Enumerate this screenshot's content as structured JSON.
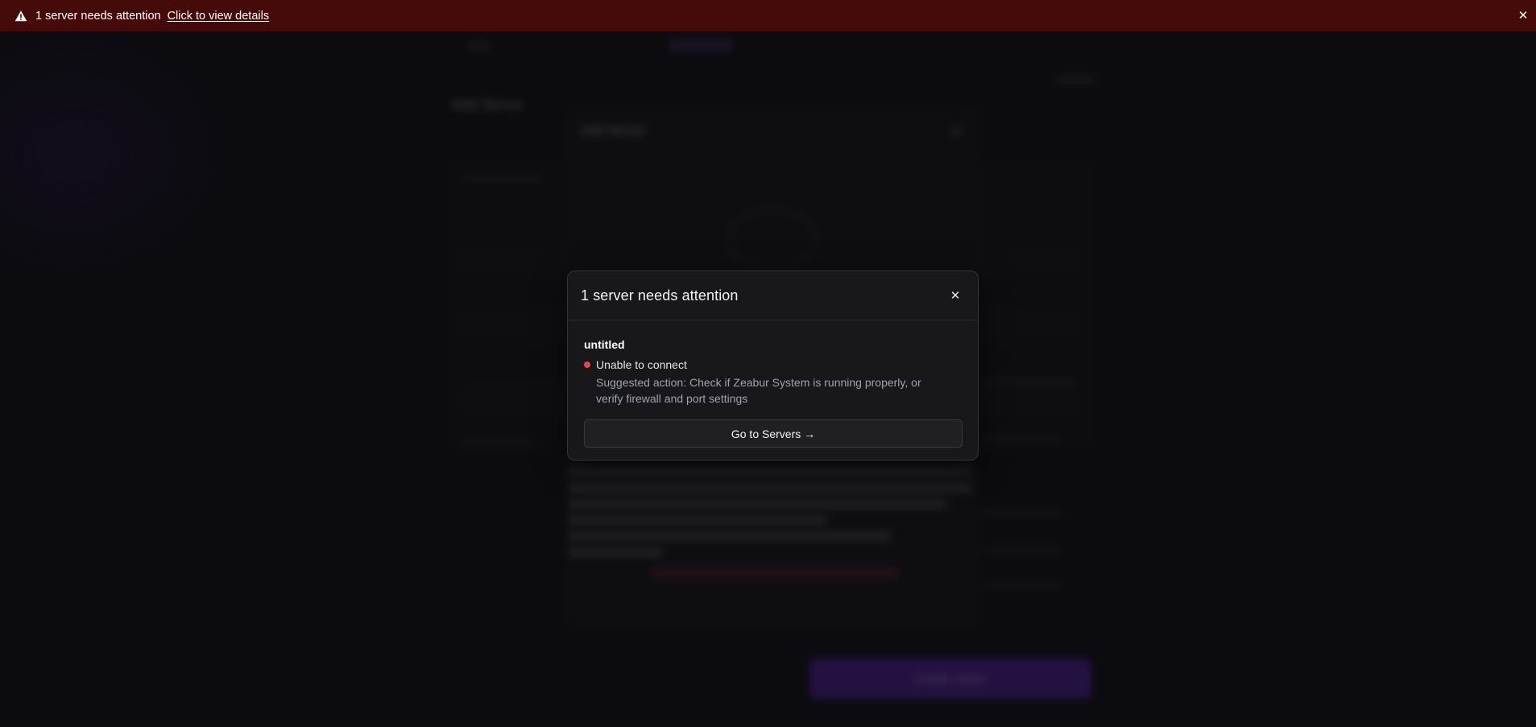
{
  "banner": {
    "message": "1 server needs attention",
    "link_label": "Click to view details",
    "close_glyph": "✕",
    "icon": "warning-icon",
    "background": "#450a0a"
  },
  "dialog": {
    "title": "1 server needs attention",
    "close_glyph": "✕",
    "server": {
      "name": "untitled",
      "status": "Unable to connect",
      "status_color": "#ef4444",
      "suggestion": "Suggested action: Check if Zeabur System is running properly, or verify firewall and port settings"
    },
    "action_label": "Go to Servers →"
  },
  "background": {
    "page_title": "Add Server",
    "modal_title": "Add Server",
    "primary_button": "Create server"
  }
}
